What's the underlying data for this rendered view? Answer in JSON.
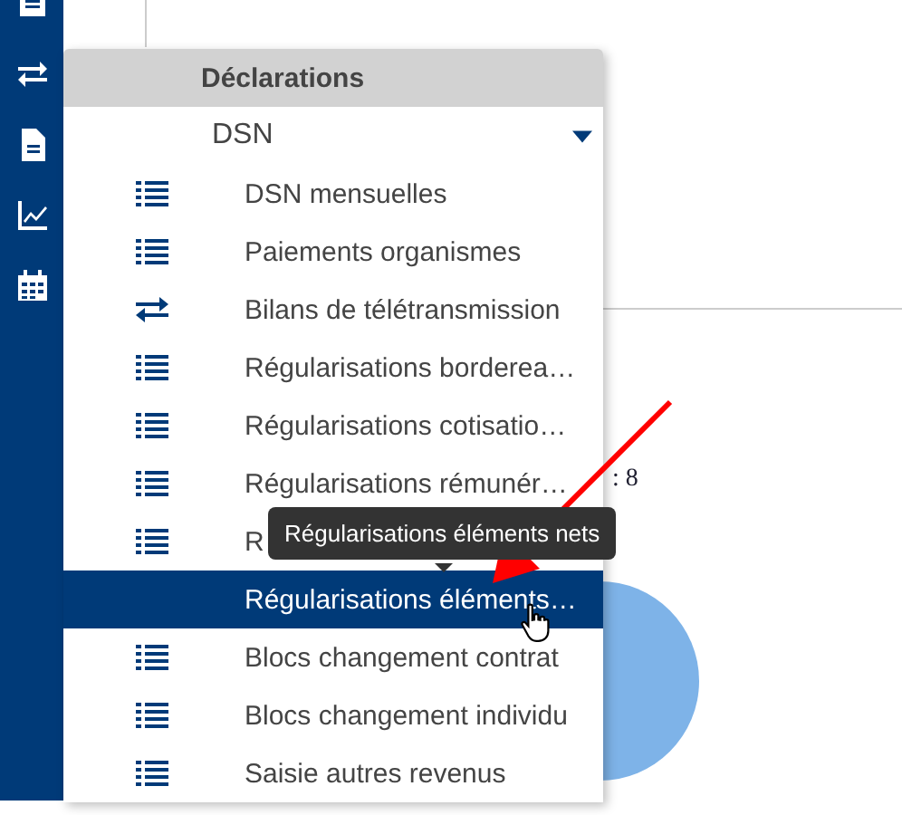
{
  "sidebar": {
    "icons": [
      {
        "kind": "doc"
      },
      {
        "kind": "arrows"
      },
      {
        "kind": "file"
      },
      {
        "kind": "chart"
      },
      {
        "kind": "calendar"
      }
    ]
  },
  "background": {
    "value_text": ": 8"
  },
  "menu": {
    "title": "Déclarations",
    "group": {
      "label": "DSN",
      "expanded": true
    },
    "items": [
      {
        "label": "DSN mensuelles",
        "kind": "list",
        "selected": false
      },
      {
        "label": "Paiements organismes",
        "kind": "list",
        "selected": false
      },
      {
        "label": "Bilans de télétransmission",
        "kind": "arrows",
        "selected": false
      },
      {
        "label": "Régularisations bordereа…",
        "kind": "list",
        "selected": false
      },
      {
        "label": "Régularisations cotisatio…",
        "kind": "list",
        "selected": false
      },
      {
        "label": "Régularisations rémunér…",
        "kind": "list",
        "selected": false
      },
      {
        "label": "R",
        "kind": "list",
        "selected": false
      },
      {
        "label": "Régularisations éléments…",
        "kind": "none",
        "selected": true
      },
      {
        "label": "Blocs changement contrat",
        "kind": "list",
        "selected": false
      },
      {
        "label": "Blocs changement individu",
        "kind": "list",
        "selected": false
      },
      {
        "label": "Saisie autres revenus",
        "kind": "list",
        "selected": false
      }
    ]
  },
  "tooltip": {
    "text": "Régularisations éléments nets"
  }
}
